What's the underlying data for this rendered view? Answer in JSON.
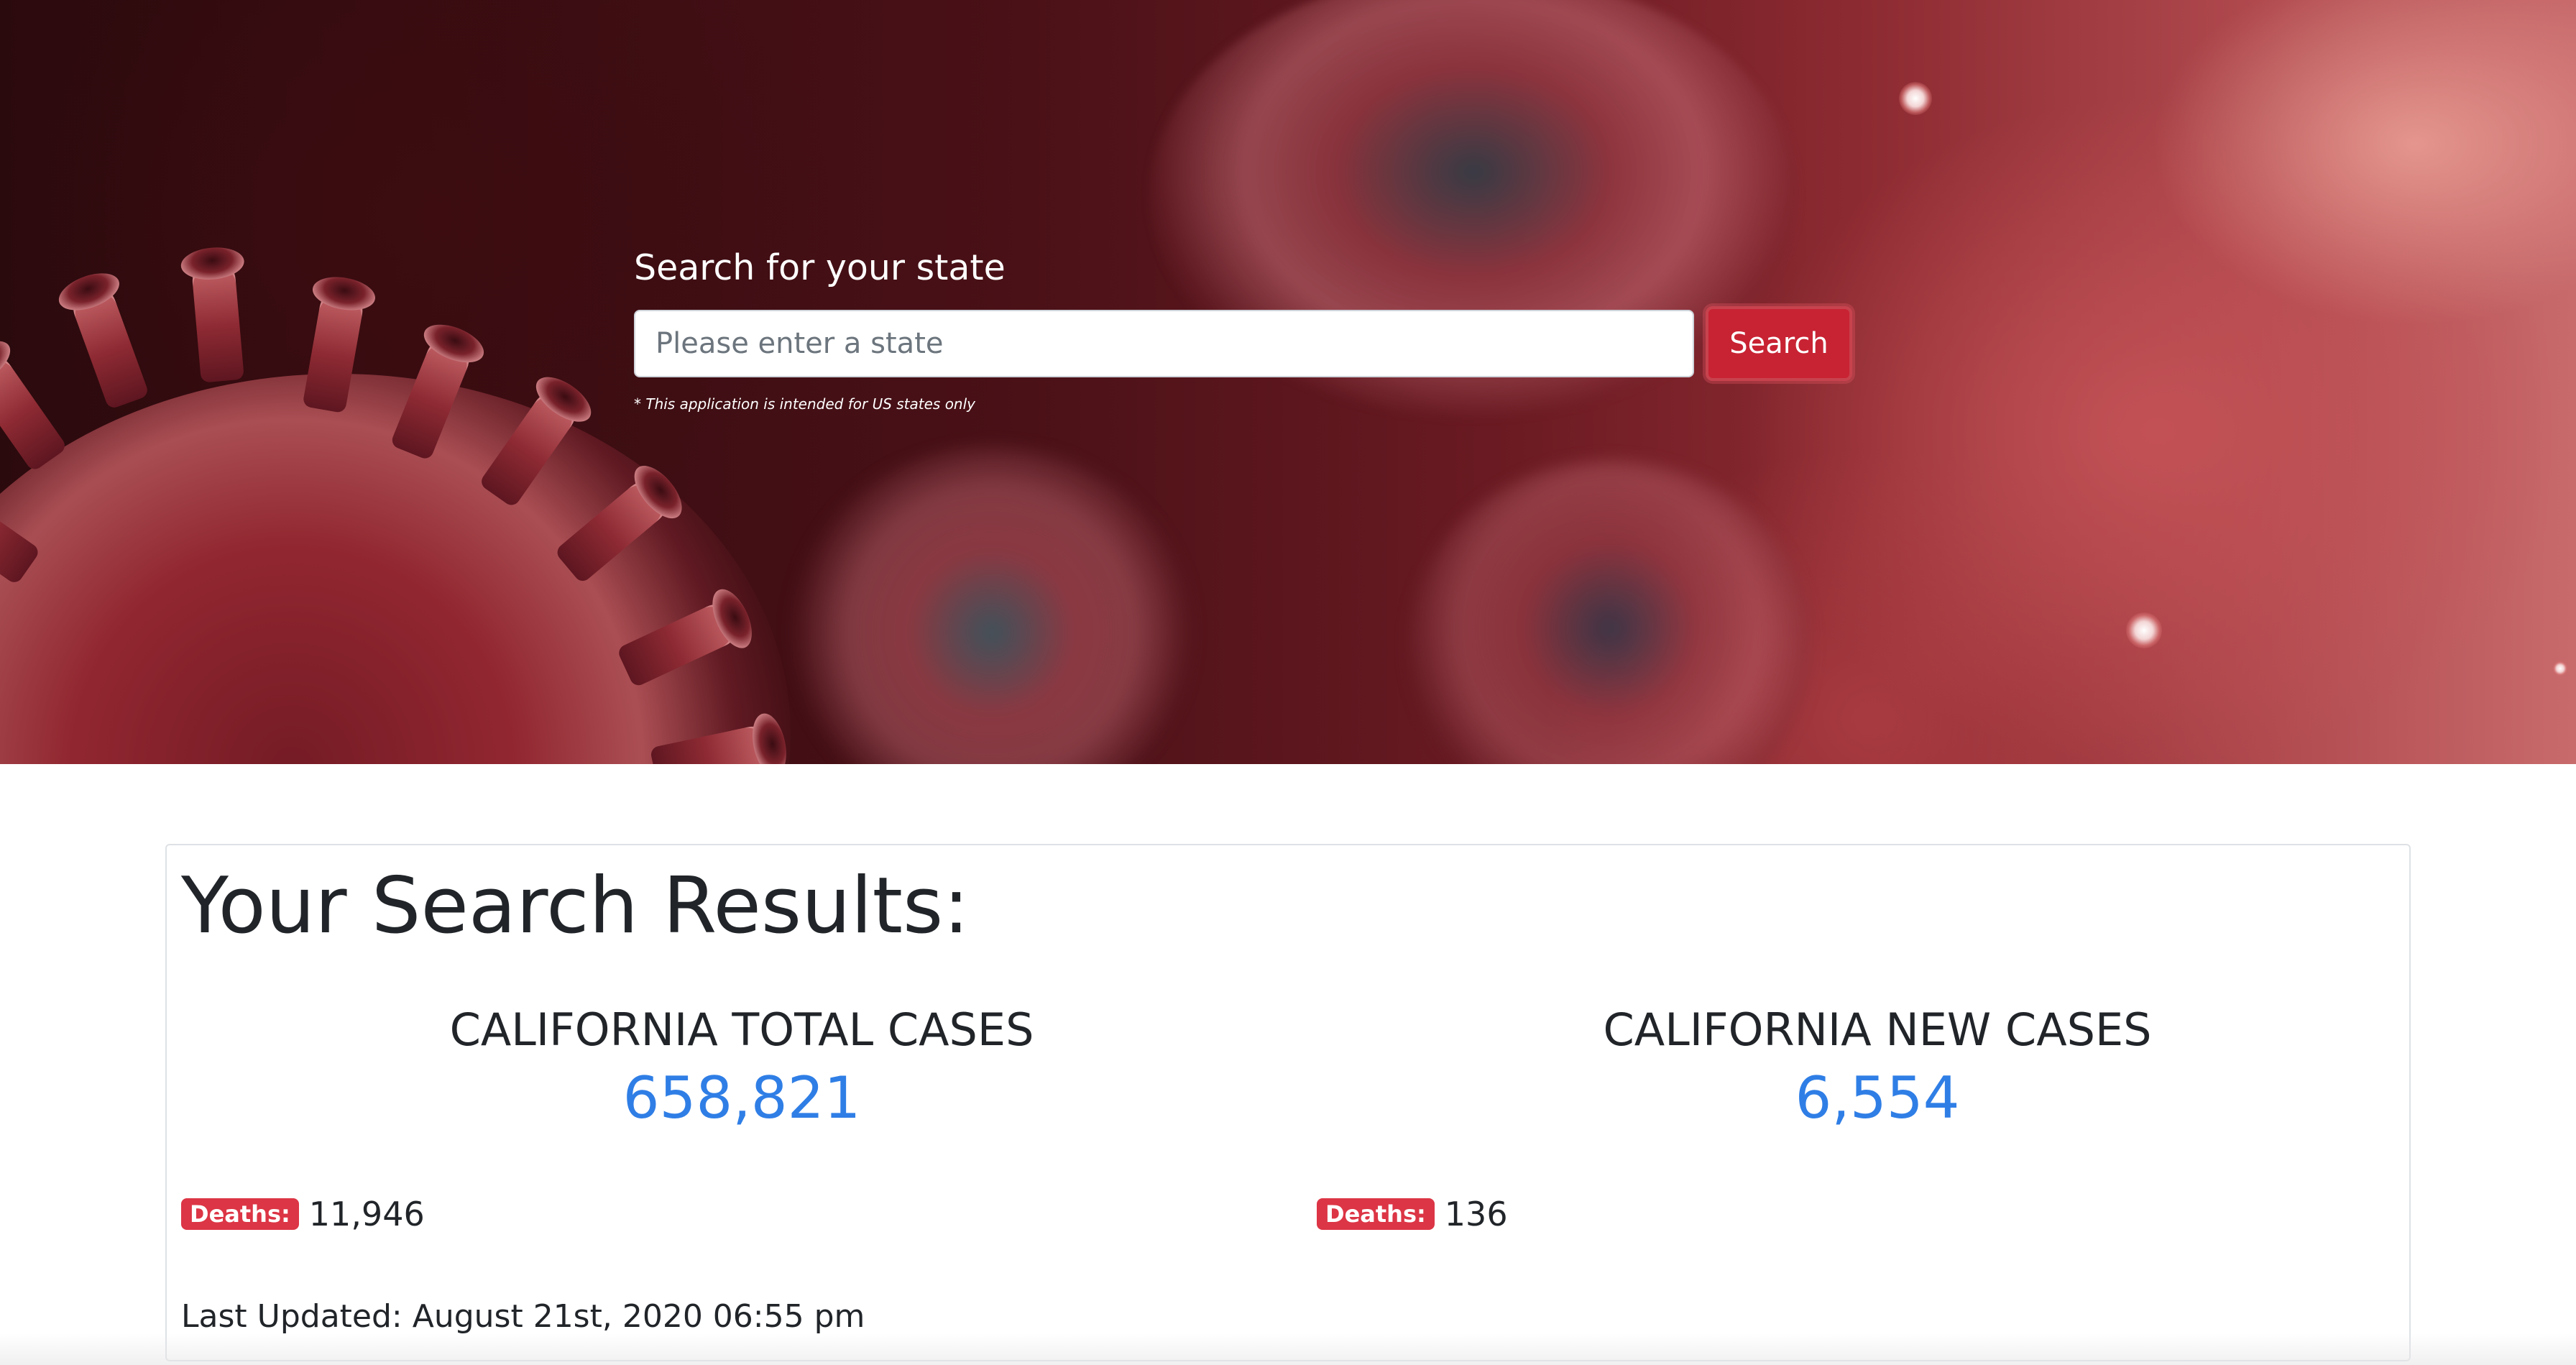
{
  "hero": {
    "search_label": "Search for your state",
    "search_placeholder": "Please enter a state",
    "search_value": "",
    "search_button_label": "Search",
    "note": "* This application is intended for US states only",
    "accent_color": "#c82333"
  },
  "results": {
    "title": "Your Search Results:",
    "total": {
      "label": "CALIFORNIA TOTAL CASES",
      "value": "658,821",
      "deaths_label": "Deaths:",
      "deaths_value": "11,946"
    },
    "new": {
      "label": "CALIFORNIA NEW CASES",
      "value": "6,554",
      "deaths_label": "Deaths:",
      "deaths_value": "136"
    },
    "last_updated": "Last Updated: August 21st, 2020 06:55 pm",
    "value_color": "#2f7ee6",
    "badge_color": "#dc3545"
  }
}
